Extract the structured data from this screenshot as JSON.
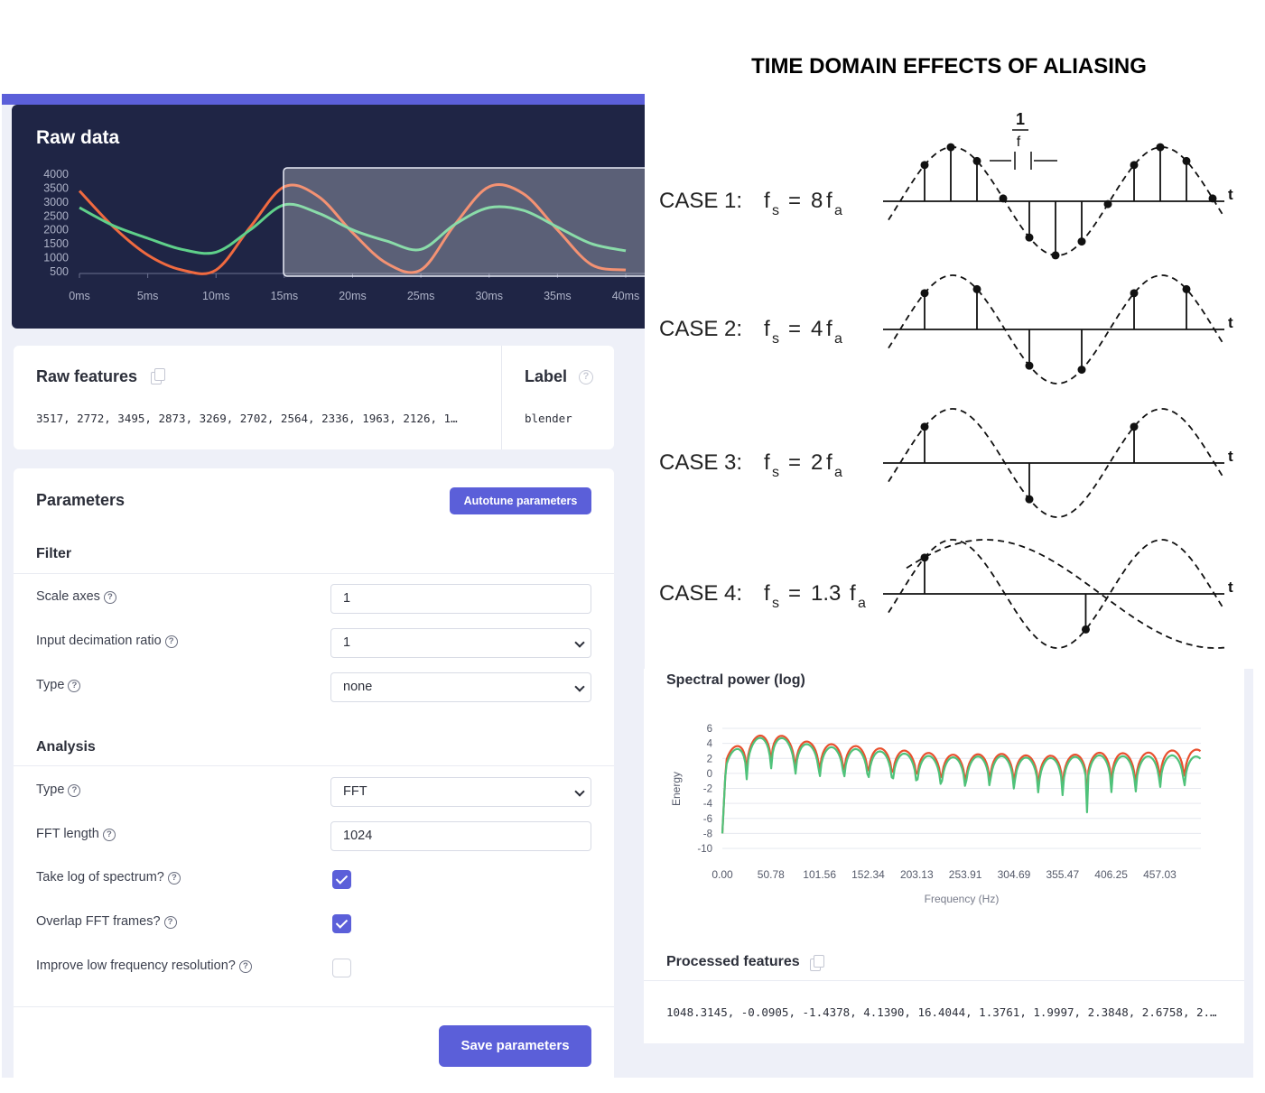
{
  "raw_data": {
    "title": "Raw data",
    "y_ticks": [
      "4000",
      "3500",
      "3000",
      "2500",
      "2000",
      "1500",
      "1000",
      "500"
    ],
    "x_ticks": [
      "0ms",
      "5ms",
      "10ms",
      "15ms",
      "20ms",
      "25ms",
      "30ms",
      "35ms",
      "40ms"
    ],
    "colors": {
      "red": "#f06a40",
      "green": "#5fd08a",
      "background": "#1f2545"
    }
  },
  "raw_features": {
    "title": "Raw features",
    "values": "3517, 2772, 3495, 2873, 3269, 2702, 2564, 2336, 1963, 2126, 1…"
  },
  "label": {
    "title": "Label",
    "value": "blender"
  },
  "parameters": {
    "title": "Parameters",
    "autotune_label": "Autotune parameters",
    "filter": {
      "heading": "Filter",
      "scale_axes_label": "Scale axes",
      "scale_axes_value": "1",
      "decimation_label": "Input decimation ratio",
      "decimation_value": "1",
      "type_label": "Type",
      "type_value": "none"
    },
    "analysis": {
      "heading": "Analysis",
      "type_label": "Type",
      "type_value": "FFT",
      "fft_length_label": "FFT length",
      "fft_length_value": "1024",
      "take_log_label": "Take log of spectrum?",
      "take_log_checked": true,
      "overlap_label": "Overlap FFT frames?",
      "overlap_checked": true,
      "improve_low_label": "Improve low frequency resolution?",
      "improve_low_checked": false
    },
    "save_label": "Save parameters"
  },
  "aliasing": {
    "title": "TIME DOMAIN EFFECTS OF ALIASING",
    "period_label_num": "1",
    "period_label_den": "f",
    "axis_label": "t",
    "cases": [
      {
        "label": "CASE 1:",
        "ratio": "8"
      },
      {
        "label": "CASE 2:",
        "ratio": "4"
      },
      {
        "label": "CASE 3:",
        "ratio": "2"
      },
      {
        "label": "CASE 4:",
        "ratio": "1.3"
      }
    ]
  },
  "spectral": {
    "title": "Spectral power (log)",
    "y_label": "Energy",
    "x_label": "Frequency (Hz)",
    "y_ticks": [
      "6",
      "4",
      "2",
      "0",
      "-2",
      "-4",
      "-6",
      "-8",
      "-10"
    ],
    "x_ticks": [
      "0.00",
      "50.78",
      "101.56",
      "152.34",
      "203.13",
      "253.91",
      "304.69",
      "355.47",
      "406.25",
      "457.03"
    ],
    "colors": {
      "red": "#e8502e",
      "green": "#4fc27a"
    }
  },
  "processed_features": {
    "title": "Processed features",
    "values": "1048.3145, -0.0905, -1.4378, 4.1390, 16.4044, 1.3761, 1.9997, 2.3848, 2.6758, 2.…"
  },
  "chart_data": [
    {
      "type": "line",
      "title": "Raw data",
      "x": [
        0,
        2.5,
        5,
        7.5,
        10,
        12.5,
        15,
        17.5,
        20,
        22.5,
        25,
        27.5,
        30,
        32.5,
        35,
        37.5,
        40
      ],
      "xlabel": "",
      "ylabel": "",
      "ylim": [
        500,
        4000
      ],
      "series": [
        {
          "values": [
            3400,
            2100,
            1100,
            560,
            560,
            2100,
            3550,
            3200,
            1900,
            800,
            560,
            2200,
            3550,
            3300,
            2000,
            750,
            560
          ]
        },
        {
          "values": [
            2800,
            2150,
            1700,
            1300,
            1200,
            2000,
            2900,
            2600,
            2000,
            1600,
            1300,
            2200,
            2800,
            2700,
            2100,
            1500,
            1250
          ]
        }
      ]
    },
    {
      "type": "line",
      "title": "Spectral power (log)",
      "xlabel": "Frequency (Hz)",
      "ylabel": "Energy",
      "ylim": [
        -10,
        6
      ],
      "x": [
        0,
        25,
        50.78,
        75,
        101.56,
        125,
        152.34,
        175,
        203.13,
        225,
        253.91,
        280,
        304.69,
        330,
        355.47,
        380,
        406.25,
        430,
        457.03,
        480,
        500
      ],
      "series": [
        {
          "values": [
            2.5,
            4.5,
            5.5,
            4.5,
            4.0,
            3.8,
            3.5,
            3.2,
            2.9,
            2.6,
            2.4,
            2.7,
            2.5,
            2.3,
            2.4,
            2.6,
            2.9,
            2.5,
            3.0,
            3.1,
            3.2
          ]
        },
        {
          "values": [
            2.0,
            4.2,
            5.2,
            4.2,
            3.6,
            3.4,
            3.1,
            2.8,
            2.5,
            2.2,
            2.1,
            2.4,
            2.2,
            2.0,
            2.1,
            2.3,
            2.5,
            2.1,
            2.4,
            2.4,
            2.2
          ]
        }
      ]
    }
  ]
}
